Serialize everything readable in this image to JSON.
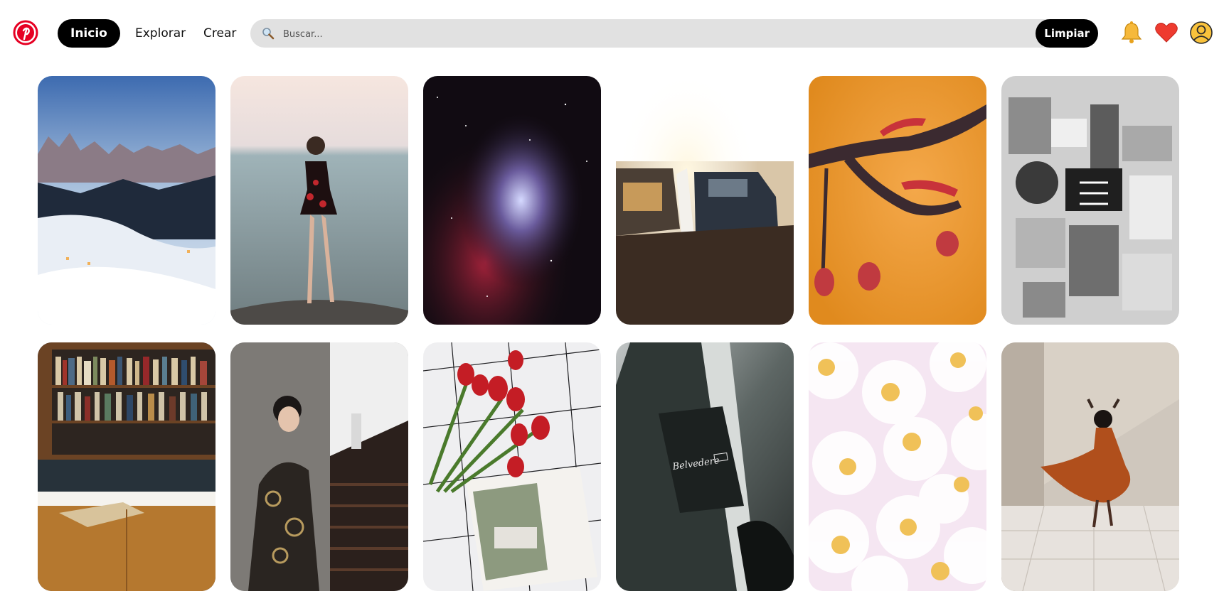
{
  "header": {
    "logo_icon": "pinterest-logo-icon",
    "nav": [
      {
        "label": "Inicio",
        "active": true
      },
      {
        "label": "Explorar",
        "active": false
      },
      {
        "label": "Crear",
        "active": false
      }
    ],
    "search": {
      "placeholder": "Buscar...",
      "value": "",
      "clear_label": "Limpiar",
      "icon": "search-icon"
    },
    "icons": {
      "bell": "bell-icon",
      "heart": "heart-icon",
      "avatar": "user-avatar-icon"
    }
  },
  "pins": [
    {
      "subject": "snowy-mountain-village"
    },
    {
      "subject": "woman-in-sea"
    },
    {
      "subject": "nebula-space"
    },
    {
      "subject": "camper-vans-sunset"
    },
    {
      "subject": "orange-macro-branch"
    },
    {
      "subject": "grayscale-cubist-art"
    },
    {
      "subject": "bookshelf-cabinet"
    },
    {
      "subject": "man-on-stairs"
    },
    {
      "subject": "tulips-magazine"
    },
    {
      "subject": "car-window-belvedere"
    },
    {
      "subject": "pink-flowers"
    },
    {
      "subject": "dancing-woman-orange-dress"
    }
  ],
  "colors": {
    "accent": "#000000",
    "search_bg": "#e1e1e1",
    "logo": "#e60023"
  }
}
